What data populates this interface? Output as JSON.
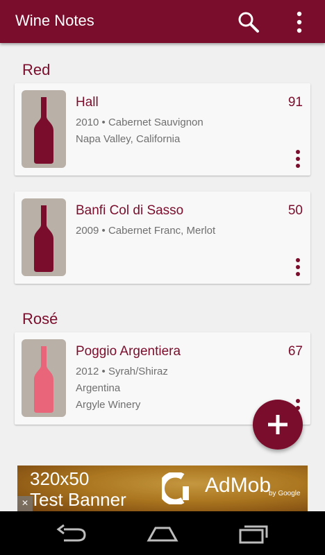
{
  "app": {
    "title": "Wine Notes"
  },
  "icons": {
    "search": "search-icon",
    "more": "more-vert-icon",
    "add": "add-icon"
  },
  "colors": {
    "primary": "#7b0d2c",
    "rose_bottle": "#e8657a",
    "thumb_bg": "#b9b0a7"
  },
  "sections": [
    {
      "title": "Red",
      "wines": [
        {
          "name": "Hall",
          "score": "91",
          "line1": "2010 • Cabernet Sauvignon",
          "line2": "Napa Valley, California"
        },
        {
          "name": "Banfi Col di Sasso",
          "score": "50",
          "line1": "2009 • Cabernet Franc, Merlot"
        }
      ]
    },
    {
      "title": "Rosé",
      "wines": [
        {
          "name": "Poggio Argentiera",
          "score": "67",
          "line1": "2012 • Syrah/Shiraz",
          "line2": "Argentina",
          "line3": "Argyle Winery"
        }
      ]
    }
  ],
  "ad": {
    "line1": "320x50",
    "line2": "Test Banner",
    "brand": "AdMob",
    "by": "by Google",
    "close": "×"
  },
  "nav": {
    "back": "back-icon",
    "home": "home-icon",
    "recents": "recents-icon"
  }
}
